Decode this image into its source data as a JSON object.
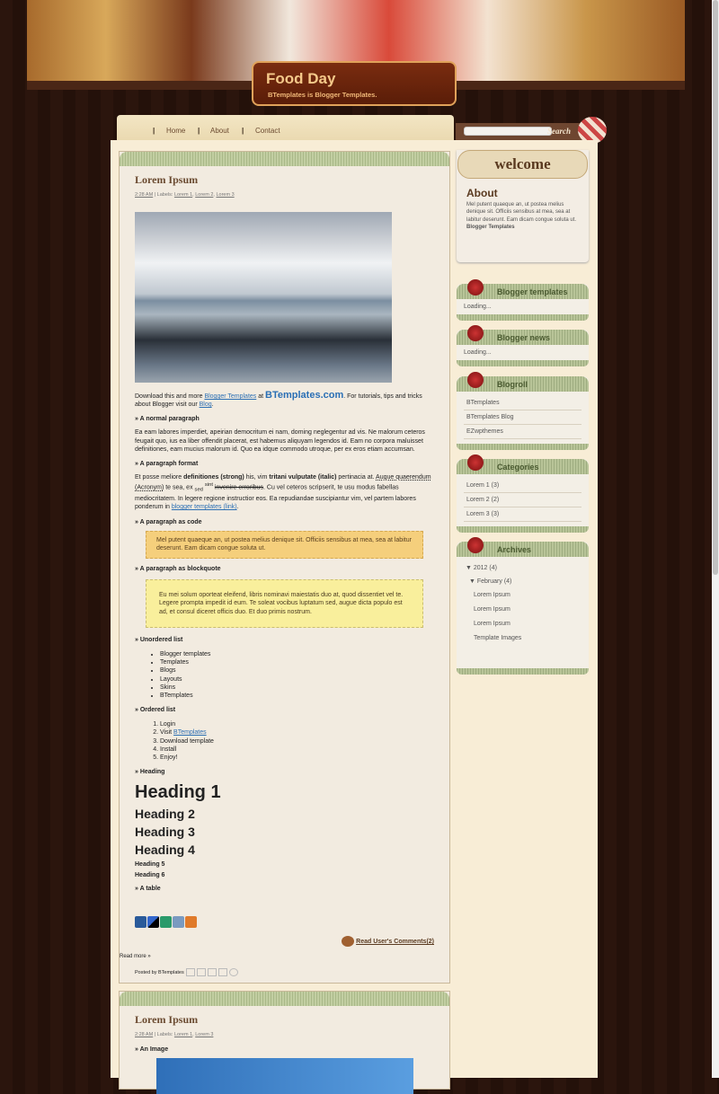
{
  "header": {
    "title": "Food Day",
    "tagline": "BTemplates is Blogger Templates."
  },
  "nav": {
    "items": [
      "Home",
      "About",
      "Contact"
    ]
  },
  "search": {
    "button": "Search",
    "placeholder": ""
  },
  "posts": [
    {
      "title": "Lorem Ipsum",
      "time": "2:28 AM",
      "labels_prefix": "| Labels:",
      "labels": [
        "Lorem 1",
        "Lorem 2",
        "Lorem 3"
      ],
      "intro": {
        "t1": "Download this and more ",
        "link1": "Blogger Templates",
        "t2": " at ",
        "logo": "BTemplates.com",
        "t3": ". For tutorials, tips and tricks about Blogger visit our ",
        "link2": "Blog",
        "t4": "."
      },
      "normal_label": "» A normal paragraph",
      "normal_text": "Ea eam labores imperdiet, apeirian democritum ei nam, doming neglegentur ad vis. Ne malorum ceteros feugait quo, ius ea liber offendit placerat, est habemus aliquyam legendos id. Eam no corpora maluisset definitiones, eam mucius malorum id. Quo ea idque commodo utroque, per ex eros etiam accumsan.",
      "format_label": "» A paragraph format",
      "format": {
        "a": "Et posse meliore ",
        "strong": "definitiones (strong)",
        "b": " his, vim ",
        "italic": "tritani vulputate (italic)",
        "c": " pertinacia at. ",
        "acronym": "Augue quaerendum (Acronym)",
        "d": " te sea, ex ",
        "sub": "sed",
        "sup": "sint",
        "strike": "invenire erroribus",
        "e": ". Cu vel ceteros scripserit, te usu modus fabellas mediocritatem. In legere regione instructior eos. Ea repudiandae suscipiantur vim, vel partem labores ponderum in ",
        "link": "blogger templates (link)",
        "f": "."
      },
      "code_label": "» A paragraph as code",
      "code_text": "Mel putent quaeque an, ut postea melius denique sit. Officiis sensibus at mea, sea at labitur deserunt. Eam dicam congue soluta ut.",
      "quote_label": "» A paragraph as blockquote",
      "quote_text": "Eu mei solum oporteat eleifend, libris nominavi maiestatis duo at, quod dissentiet vel te. Legere prompta impedit id eum. Te soleat vocibus luptatum sed, augue dicta populo est ad, et consul diceret officis duo. Et duo primis nostrum.",
      "ul_label": "» Unordered list",
      "ul": [
        "Blogger templates",
        "Templates",
        "Blogs",
        "Layouts",
        "Skins",
        "BTemplates"
      ],
      "ol_label": "» Ordered list",
      "ol": [
        "Login",
        "Visit ",
        "Download template",
        "Install",
        "Enjoy!"
      ],
      "ol_link": "BTemplates",
      "heading_label": "» Heading",
      "headings": [
        "Heading 1",
        "Heading 2",
        "Heading 3",
        "Heading 4",
        "Heading 5",
        "Heading 6"
      ],
      "table_label": "» A table",
      "comments": "Read User's Comments(2)",
      "read_more": "Read more »",
      "posted_by": "Posted by BTemplates"
    },
    {
      "title": "Lorem Ipsum",
      "time": "2:28 AM",
      "labels_prefix": "| Labels:",
      "labels": [
        "Lorem 1",
        "Lorem 3"
      ],
      "image_label": "» An Image"
    }
  ],
  "sidebar": {
    "welcome": "welcome",
    "about": {
      "title": "About",
      "text": "Mel putent quaeque an, ut postea melius denique sit. Officiis sensibus at mea, sea at labitur deserunt. Eam dicam congue soluta ut. ",
      "bold": "Blogger Templates"
    },
    "widgets": [
      {
        "title": "Blogger templates",
        "loading": "Loading..."
      },
      {
        "title": "Blogger news",
        "loading": "Loading..."
      },
      {
        "title": "Blogroll",
        "items": [
          "BTemplates",
          "BTemplates Blog",
          "EZwpthemes"
        ]
      },
      {
        "title": "Categories",
        "items": [
          "Lorem 1 (3)",
          "Lorem 2 (2)",
          "Lorem 3 (3)"
        ]
      },
      {
        "title": "Archives",
        "year": "▼ 2012 (4)",
        "month": "▼ February (4)",
        "items": [
          "Lorem Ipsum",
          "Lorem Ipsum",
          "Lorem Ipsum",
          "Template Images"
        ]
      }
    ]
  },
  "colors": {
    "background": "#2b150d",
    "content": "#f8edd6",
    "accent_green": "#b8c498",
    "title_brown": "#6a4a30",
    "link": "#2c6fb3"
  }
}
